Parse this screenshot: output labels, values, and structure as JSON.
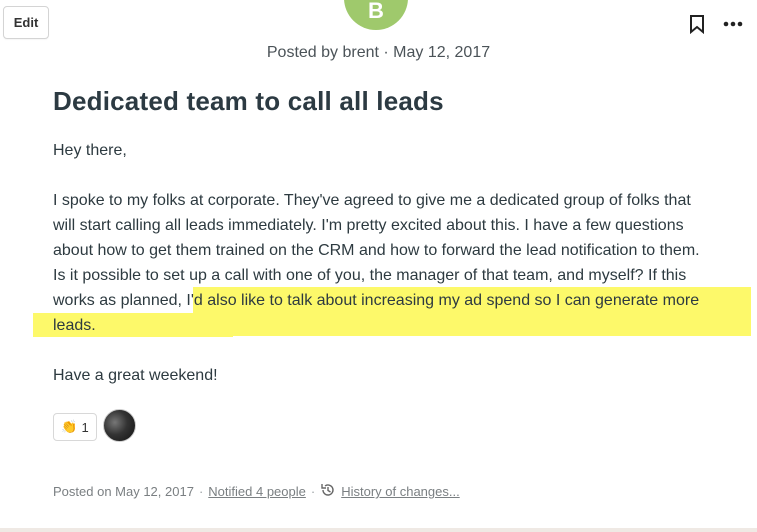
{
  "toolbar": {
    "edit_label": "Edit"
  },
  "post": {
    "author_initial": "B",
    "meta_top": "Posted by brent · May 12, 2017",
    "title": "Dedicated team to call all leads",
    "greeting": "Hey there,",
    "body_main": "I spoke to my folks at corporate.  They've agreed to give me a dedicated group of folks that will start calling all leads immediately.  I'm pretty excited about this.  I have a few questions about how to get them trained on the CRM and how to forward the lead notification to them.  Is it possible to set up a call with one of you, the manager of that team, and myself?",
    "body_highlight": "If this works as planned, I'd also like to talk about increasing my ad spend so I can generate more leads.",
    "closing": "Have a great weekend!"
  },
  "reactions": {
    "emoji": "👏",
    "count": "1"
  },
  "footer": {
    "posted": "Posted on May 12, 2017",
    "notified": "Notified 4 people",
    "history": "History of changes..."
  },
  "colors": {
    "highlight": "#fdf96a",
    "avatar": "#9fc96c"
  }
}
